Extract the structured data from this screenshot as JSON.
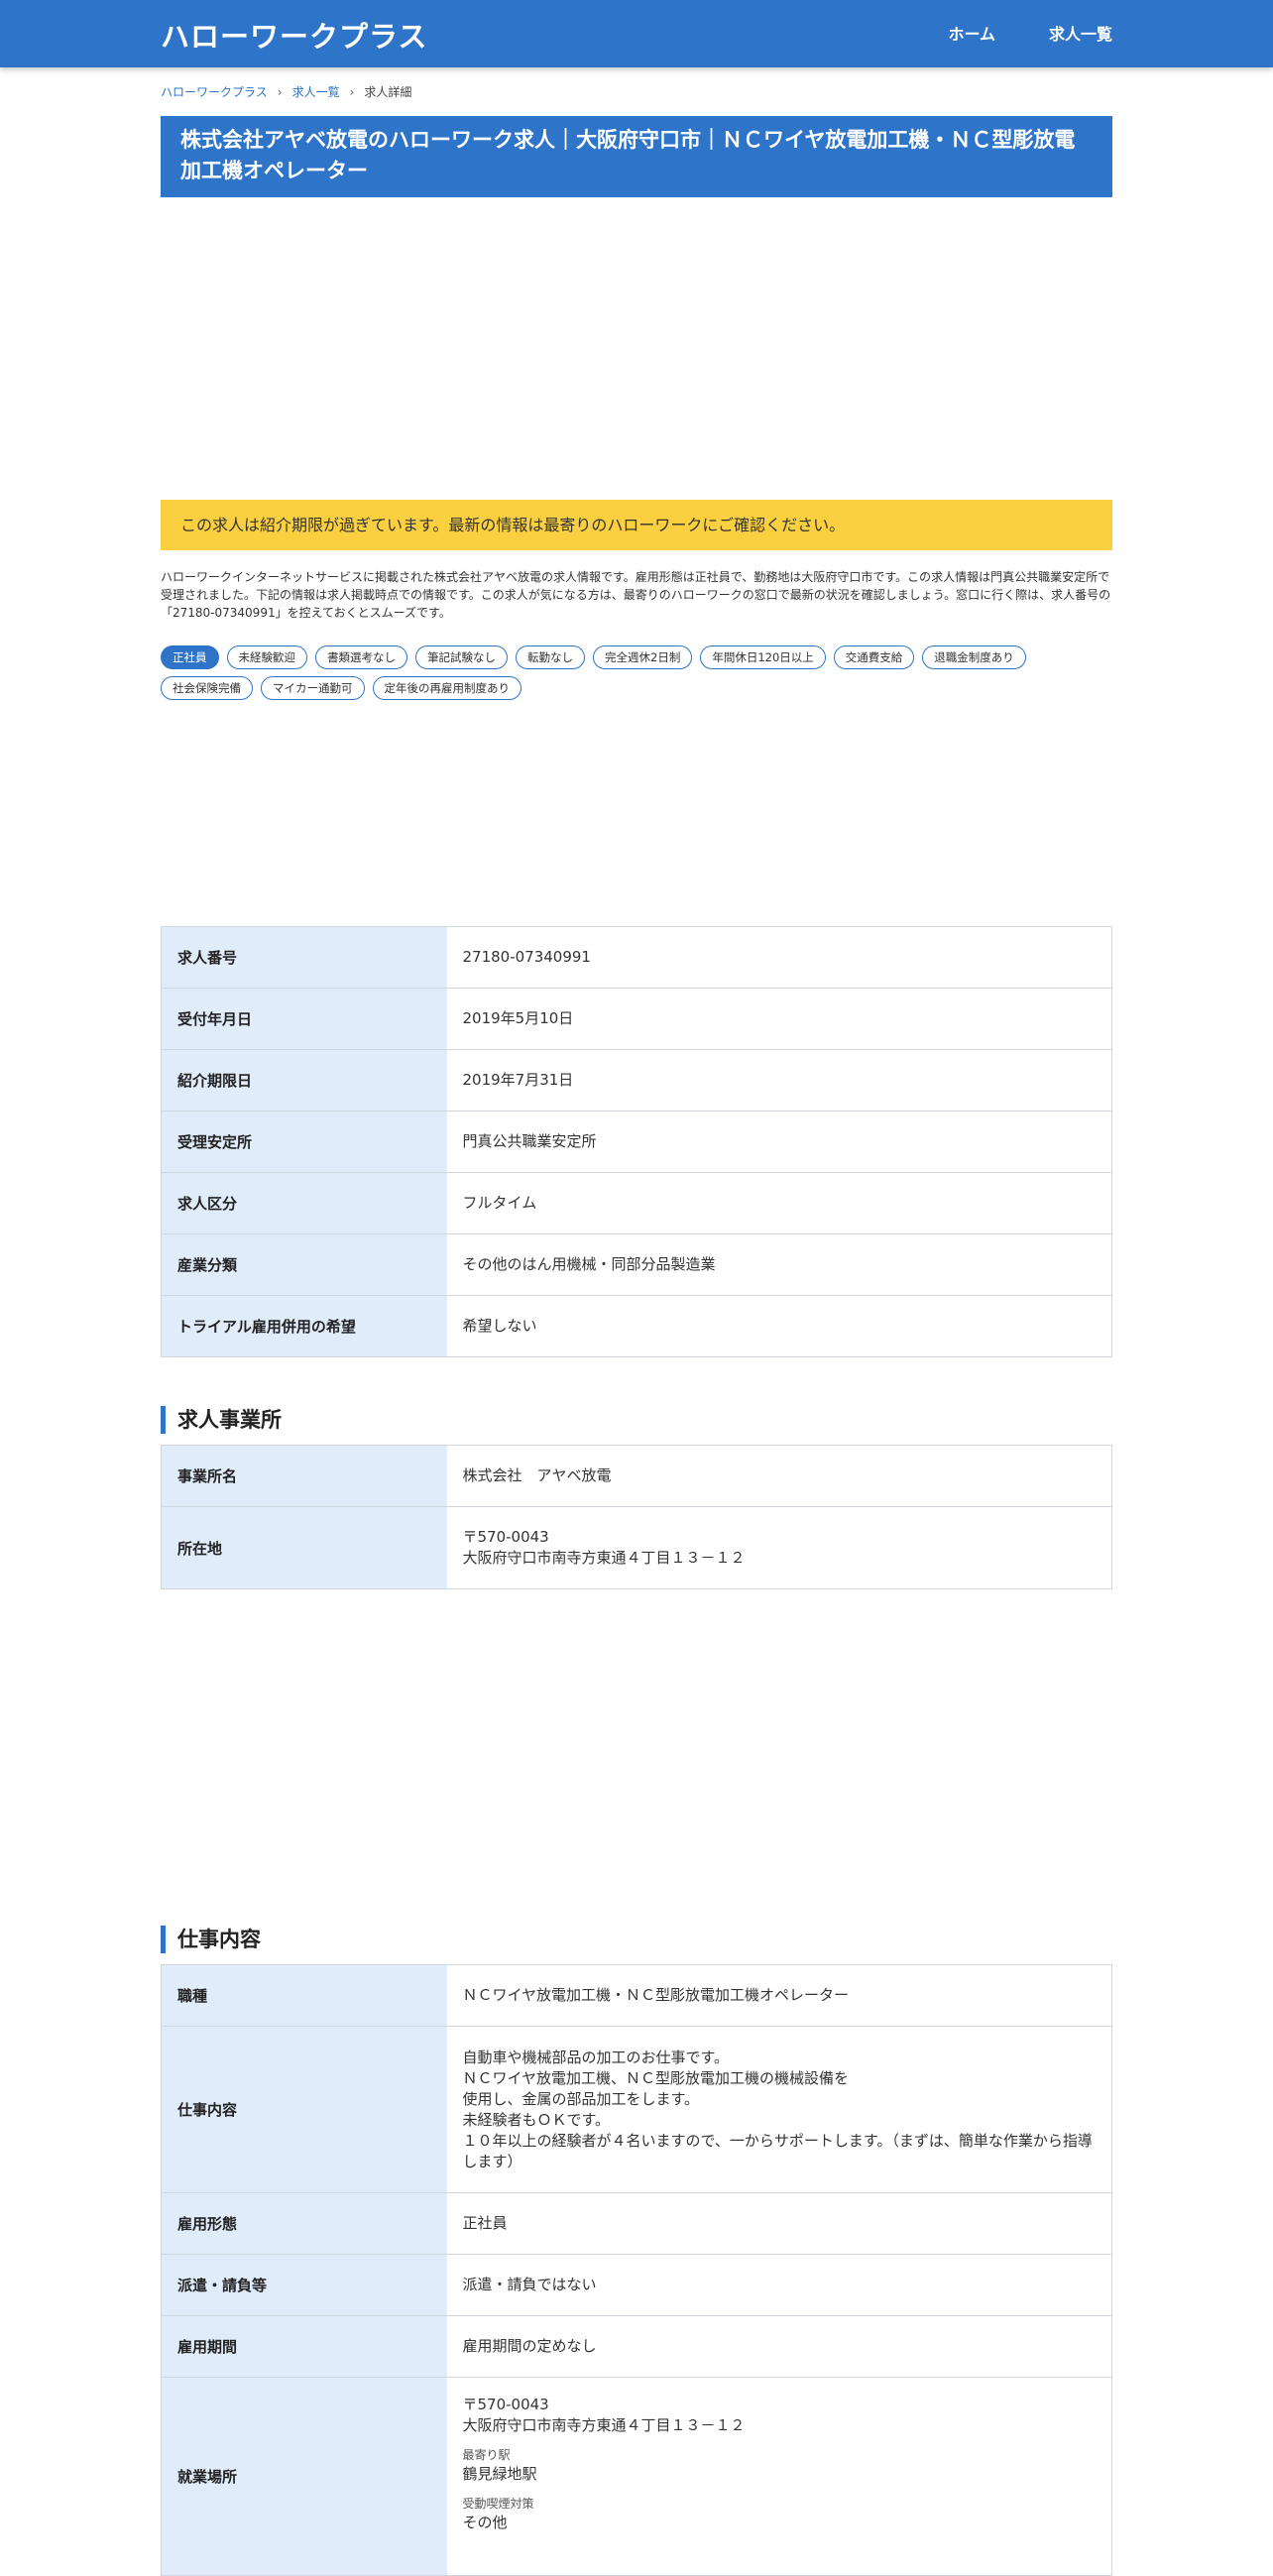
{
  "header": {
    "logo": "ハローワークプラス",
    "nav": [
      "ホーム",
      "求人一覧"
    ]
  },
  "breadcrumb": [
    "ハローワークプラス",
    "求人一覧",
    "求人詳細"
  ],
  "page_title": "株式会社アヤベ放電のハローワーク求人｜大阪府守口市｜ＮＣワイヤ放電加工機・ＮＣ型彫放電加工機オペレーター",
  "notice": "この求人は紹介期限が過ぎています。最新の情報は最寄りのハローワークにご確認ください。",
  "intro": "ハローワークインターネットサービスに掲載された株式会社アヤベ放電の求人情報です。雇用形態は正社員で、勤務地は大阪府守口市です。この求人情報は門真公共職業安定所で受理されました。下記の情報は求人掲載時点での情報です。この求人が気になる方は、最寄りのハローワークの窓口で最新の状況を確認しましょう。窓口に行く際は、求人番号の「27180-07340991」を控えておくとスムーズです。",
  "tags": [
    {
      "label": "正社員",
      "active": true
    },
    {
      "label": "未経験歓迎",
      "active": false
    },
    {
      "label": "書類選考なし",
      "active": false
    },
    {
      "label": "筆記試験なし",
      "active": false
    },
    {
      "label": "転勤なし",
      "active": false
    },
    {
      "label": "完全週休2日制",
      "active": false
    },
    {
      "label": "年間休日120日以上",
      "active": false
    },
    {
      "label": "交通費支給",
      "active": false
    },
    {
      "label": "退職金制度あり",
      "active": false
    },
    {
      "label": "社会保険完備",
      "active": false
    },
    {
      "label": "マイカー通勤可",
      "active": false
    },
    {
      "label": "定年後の再雇用制度あり",
      "active": false
    }
  ],
  "basic": [
    {
      "label": "求人番号",
      "value": "27180-07340991"
    },
    {
      "label": "受付年月日",
      "value": "2019年5月10日"
    },
    {
      "label": "紹介期限日",
      "value": "2019年7月31日"
    },
    {
      "label": "受理安定所",
      "value": "門真公共職業安定所"
    },
    {
      "label": "求人区分",
      "value": "フルタイム"
    },
    {
      "label": "産業分類",
      "value": "その他のはん用機械・同部分品製造業"
    },
    {
      "label": "トライアル雇用併用の希望",
      "value": "希望しない"
    }
  ],
  "office": {
    "title": "求人事業所",
    "name_label": "事業所名",
    "name": "株式会社　アヤベ放電",
    "address_label": "所在地",
    "postal": "〒570-0043",
    "address": "大阪府守口市南寺方東通４丁目１３－１２"
  },
  "job": {
    "title": "仕事内容",
    "occupation_label": "職種",
    "occupation": "ＮＣワイヤ放電加工機・ＮＣ型彫放電加工機オペレーター",
    "description_label": "仕事内容",
    "description": [
      "自動車や機械部品の加工のお仕事です。",
      "ＮＣワイヤ放電加工機、ＮＣ型彫放電加工機の機械設備を",
      "使用し、金属の部品加工をします。",
      "未経験者もＯＫです。",
      "１０年以上の経験者が４名いますので、一からサポートします。（まずは、簡単な作業から指導します）"
    ],
    "employment_label": "雇用形態",
    "employment": "正社員",
    "dispatch_label": "派遣・請負等",
    "dispatch": "派遣・請負ではない",
    "period_label": "雇用期間",
    "period": "雇用期間の定めなし",
    "place_label": "就業場所",
    "place_postal": "〒570-0043",
    "place_address": "大阪府守口市南寺方東通４丁目１３－１２",
    "station_label": "最寄り駅",
    "station": "鶴見緑地駅",
    "smoking_label": "受動喫煙対策",
    "smoking": "その他"
  }
}
